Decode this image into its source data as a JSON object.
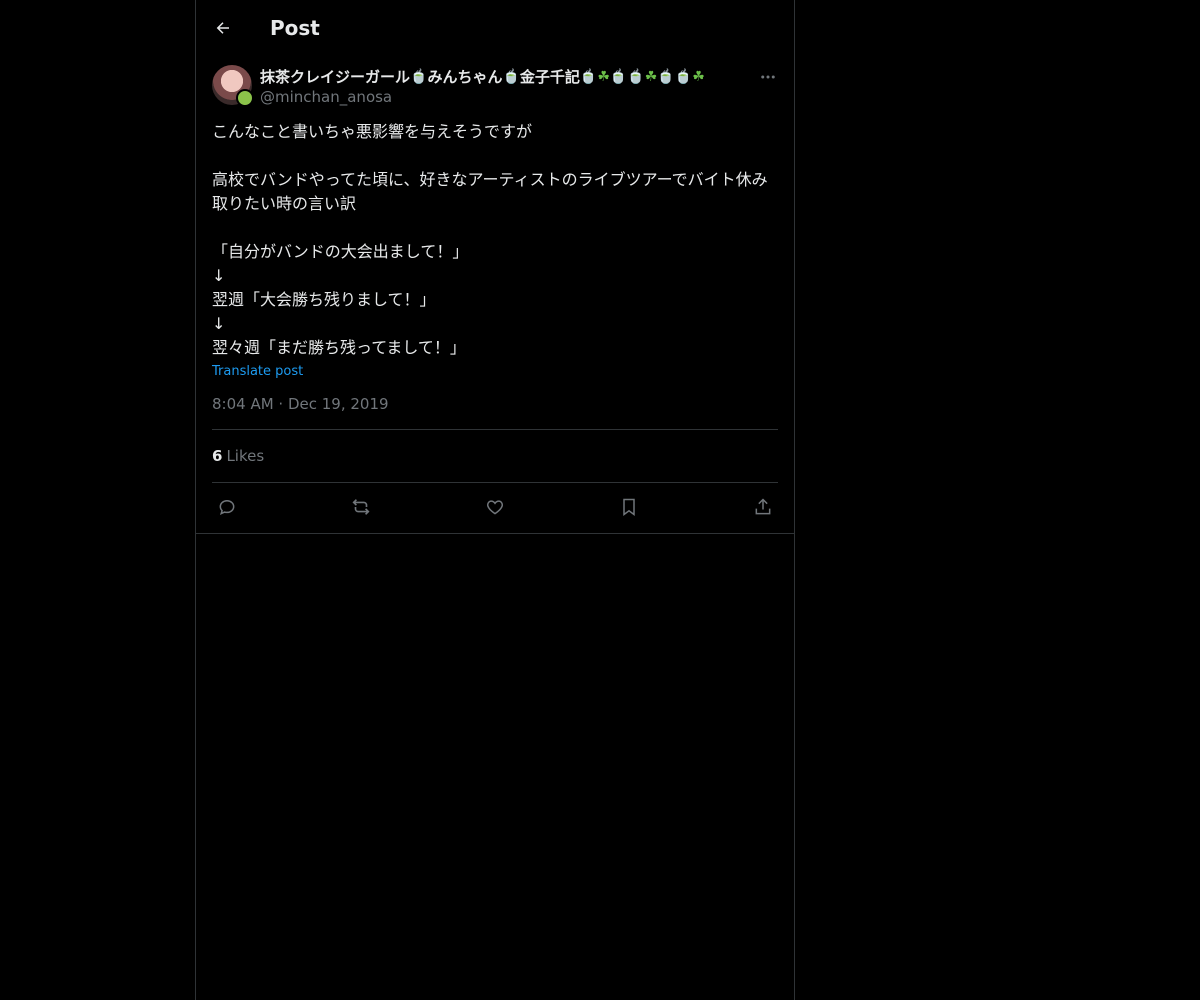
{
  "header": {
    "title": "Post",
    "back_icon": "arrow-left-icon"
  },
  "post": {
    "author": {
      "display_name_parts": [
        {
          "type": "text",
          "value": "抹茶クレイジーガール"
        },
        {
          "type": "emoji",
          "kind": "bowl",
          "value": "🍵"
        },
        {
          "type": "text",
          "value": "みんちゃん"
        },
        {
          "type": "emoji",
          "kind": "bowl",
          "value": "🍵"
        },
        {
          "type": "text",
          "value": "金子千記"
        },
        {
          "type": "emoji",
          "kind": "bowl",
          "value": "🍵"
        },
        {
          "type": "emoji",
          "kind": "clover",
          "value": "☘"
        },
        {
          "type": "emoji",
          "kind": "bowl",
          "value": "🍵"
        },
        {
          "type": "emoji",
          "kind": "bowl",
          "value": "🍵"
        },
        {
          "type": "emoji",
          "kind": "clover",
          "value": "☘"
        },
        {
          "type": "emoji",
          "kind": "bowl",
          "value": "🍵"
        },
        {
          "type": "emoji",
          "kind": "bowl",
          "value": "🍵"
        },
        {
          "type": "emoji",
          "kind": "clover",
          "value": "☘"
        }
      ],
      "handle": "@minchan_anosa"
    },
    "text_lines": [
      "こんなこと書いちゃ悪影響を与えそうですが",
      "",
      "高校でバンドやってた頃に、好きなアーティストのライブツアーでバイト休み取りたい時の言い訳",
      "",
      "「自分がバンドの大会出まして！」",
      "↓",
      "翌週「大会勝ち残りまして！」",
      "↓",
      "翌々週「まだ勝ち残ってまして！」"
    ],
    "translate_label": "Translate post",
    "timestamp": "8:04 AM · Dec 19, 2019",
    "likes_count": "6",
    "likes_label": "Likes"
  },
  "actions": [
    "reply-icon",
    "repost-icon",
    "like-icon",
    "bookmark-icon",
    "share-icon"
  ],
  "colors": {
    "background": "#000000",
    "text": "#e7e9ea",
    "muted": "#71767b",
    "link": "#1d9bf0",
    "border": "#2f3336"
  }
}
